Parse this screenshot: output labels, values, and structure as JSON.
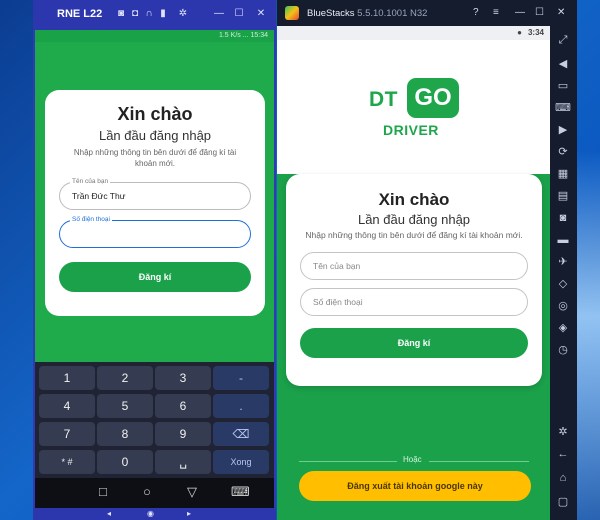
{
  "left_window": {
    "title": "RNE L22",
    "title_icons": [
      "camera-icon",
      "camera-icon",
      "headphones-icon",
      "battery-icon",
      "gear-icon"
    ],
    "controls": [
      "—",
      "☐",
      "✕"
    ],
    "status_left": "",
    "status_right": "1.5 K/s ... 15:34",
    "card": {
      "heading": "Xin chào",
      "subheading": "Lần đầu đăng nhập",
      "description": "Nhập những thông tin bên dưới để đăng kí tài khoản mới.",
      "name_label": "Tên của bạn",
      "name_value": "Trần Đức Thư",
      "phone_label": "Số điện thoại",
      "phone_value": "",
      "register_button": "Đăng kí"
    },
    "keyboard": {
      "keys": [
        [
          "1",
          "2",
          "3",
          "-"
        ],
        [
          "4",
          "5",
          "6",
          "."
        ],
        [
          "7",
          "8",
          "9",
          "⌫"
        ],
        [
          "* #",
          "0",
          "␣",
          "Xong"
        ]
      ]
    },
    "nav": [
      "□",
      "○",
      "▽",
      "⌨"
    ]
  },
  "right_window": {
    "title": "BlueStacks",
    "version": "5.5.10.1001 N32",
    "status_time": "3:34",
    "logo": {
      "dt": "DT",
      "go": "GO",
      "driver": "DRIVER"
    },
    "card": {
      "heading": "Xin chào",
      "subheading": "Lần đầu đăng nhập",
      "description": "Nhập những thông tin bên dưới để đăng kí tài khoản mới.",
      "name_placeholder": "Tên của bạn",
      "phone_placeholder": "Số điện thoại",
      "register_button": "Đăng kí"
    },
    "or_text": "Hoặc",
    "google_button": "Đăng xuất tài khoản google này"
  },
  "colors": {
    "brand_green": "#1fa64b",
    "button_yellow": "#ffbf00",
    "input_focus_blue": "#1e6fd9"
  }
}
